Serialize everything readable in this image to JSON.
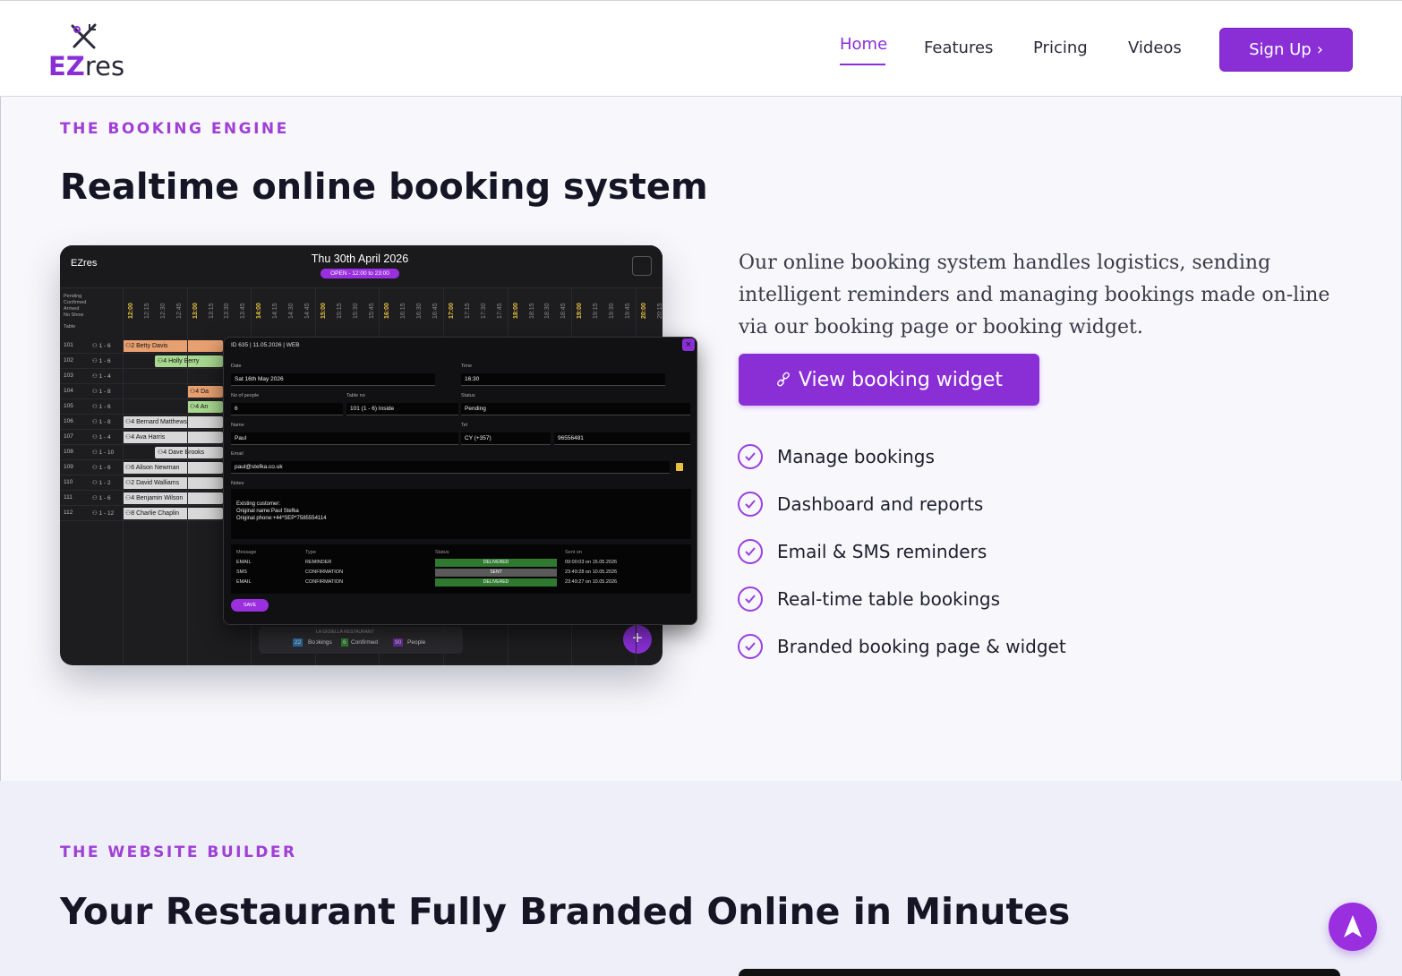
{
  "header": {
    "logo": {
      "brand_ez": "EZ",
      "brand_res": "res"
    },
    "nav": [
      {
        "label": "Home",
        "active": true
      },
      {
        "label": "Features",
        "active": false
      },
      {
        "label": "Pricing",
        "active": false
      },
      {
        "label": "Videos",
        "active": false
      }
    ],
    "signup_label": "Sign Up",
    "signup_chevron": "›"
  },
  "booking_section": {
    "eyebrow": "THE BOOKING ENGINE",
    "title": "Realtime online booking system",
    "description": "Our online booking system handles logistics, sending intelligent reminders and managing bookings made on-line via our booking page or booking widget.",
    "cta_label": "View booking widget",
    "cta_icon": "link-icon",
    "features": [
      "Manage bookings",
      "Dashboard and reports",
      "Email & SMS reminders",
      "Real-time table bookings",
      "Branded booking page & widget"
    ]
  },
  "mockup": {
    "logo": "EZres",
    "date": "Thu 30th April 2026",
    "open_badge": "OPEN - 12:00 to 23:00",
    "legend": [
      "Pending",
      "Confirmed",
      "Arrived",
      "No Show"
    ],
    "table_header": "Table",
    "times": [
      "12:00",
      "12:15",
      "12:30",
      "12:45",
      "13:00",
      "13:15",
      "13:30",
      "13:45",
      "14:00",
      "14:15",
      "14:30",
      "14:45",
      "15:00",
      "15:15",
      "15:30",
      "15:45",
      "16:00",
      "16:15",
      "16:30",
      "16:45",
      "17:00",
      "17:15",
      "17:30",
      "17:45",
      "18:00",
      "18:15",
      "18:30",
      "18:45",
      "19:00",
      "19:15",
      "19:30",
      "19:45",
      "20:00",
      "20:15"
    ],
    "rows": [
      {
        "table": "101",
        "cap": "1 - 6"
      },
      {
        "table": "102",
        "cap": "1 - 6"
      },
      {
        "table": "103",
        "cap": "1 - 4"
      },
      {
        "table": "104",
        "cap": "1 - 8"
      },
      {
        "table": "105",
        "cap": "1 - 6"
      },
      {
        "table": "106",
        "cap": "1 - 8"
      },
      {
        "table": "107",
        "cap": "1 - 4"
      },
      {
        "table": "108",
        "cap": "1 - 10"
      },
      {
        "table": "109",
        "cap": "1 - 6"
      },
      {
        "table": "110",
        "cap": "1 - 2"
      },
      {
        "table": "111",
        "cap": "1 - 6"
      },
      {
        "table": "112",
        "cap": "1 - 12"
      }
    ],
    "bookings": [
      {
        "row": 0,
        "people": "2",
        "name": "Betty Davis",
        "color": "#e8a070"
      },
      {
        "row": 1,
        "people": "4",
        "name": "Holly Berry",
        "color": "#a8d890"
      },
      {
        "row": 3,
        "people": "4",
        "name": "Da",
        "color": "#e8a070"
      },
      {
        "row": 4,
        "people": "4",
        "name": "An",
        "color": "#a8d890"
      },
      {
        "row": 5,
        "people": "4",
        "name": "Bernard Matthews",
        "color": "#d8d8d8"
      },
      {
        "row": 6,
        "people": "4",
        "name": "Ava Harris",
        "color": "#d8d8d8"
      },
      {
        "row": 7,
        "people": "4",
        "name": "Dave Brooks",
        "color": "#d8d8d8"
      },
      {
        "row": 8,
        "people": "6",
        "name": "Alison Newman",
        "color": "#d8d8d8"
      },
      {
        "row": 9,
        "people": "2",
        "name": "David Walliams",
        "color": "#d8d8d8"
      },
      {
        "row": 10,
        "people": "4",
        "name": "Benjamin Wilson",
        "color": "#d8d8d8"
      },
      {
        "row": 11,
        "people": "8",
        "name": "Charlie Chaplin",
        "color": "#d8d8d8"
      }
    ],
    "footer": {
      "bookings_count": "22",
      "bookings_label": "Bookings",
      "confirmed_count": "6",
      "confirmed_label": "Confirmed",
      "people_count": "90",
      "people_label": "People",
      "restaurant": "LA GIOIELLA RESTAURANT"
    },
    "plus": "+",
    "modal": {
      "header": "ID 635 | 11.05.2026 | WEB",
      "close": "×",
      "date_label": "Date",
      "date_value": "Sat 16th May 2026",
      "time_label": "Time",
      "time_value": "16:30",
      "people_label": "No of people",
      "people_value": "6",
      "table_label": "Table no",
      "table_value": "101 (1 - 6) Inside",
      "status_label": "Status",
      "status_value": "Pending",
      "name_label": "Name",
      "name_value": "Paul",
      "tel_label": "Tel",
      "tel_country": "CY (+357)",
      "tel_value": "96556481",
      "email_label": "Email",
      "email_value": "paul@stefka.co.uk",
      "notes_label": "Notes",
      "notes": [
        "Existing customer:",
        "Original name:Paul Stefka",
        "Original phone:+44*SEP*7585554114"
      ],
      "msg_headers": [
        "Message",
        "Type",
        "Status",
        "Sent on"
      ],
      "messages": [
        {
          "message": "EMAIL",
          "type": "REMINDER",
          "status": "DELIVERED",
          "sent": "09:00:03 on 15.05.2026",
          "color": "#2f7a2f"
        },
        {
          "message": "SMS",
          "type": "CONFIRMATION",
          "status": "SENT",
          "sent": "23:49:28 on 10.05.2026",
          "color": "#5a5a5a"
        },
        {
          "message": "EMAIL",
          "type": "CONFIRMATION",
          "status": "DELIVERED",
          "sent": "23:49:27 on 10.05.2026",
          "color": "#2f7a2f"
        }
      ],
      "save": "SAVE"
    }
  },
  "website_section": {
    "eyebrow": "THE WEBSITE BUILDER",
    "title": "Your Restaurant Fully Branded Online in Minutes"
  },
  "scroll_top_icon": "arrow-up-icon",
  "colors": {
    "accent": "#8a2fd6",
    "eyebrow": "#a03fd6",
    "heading": "#151525"
  }
}
